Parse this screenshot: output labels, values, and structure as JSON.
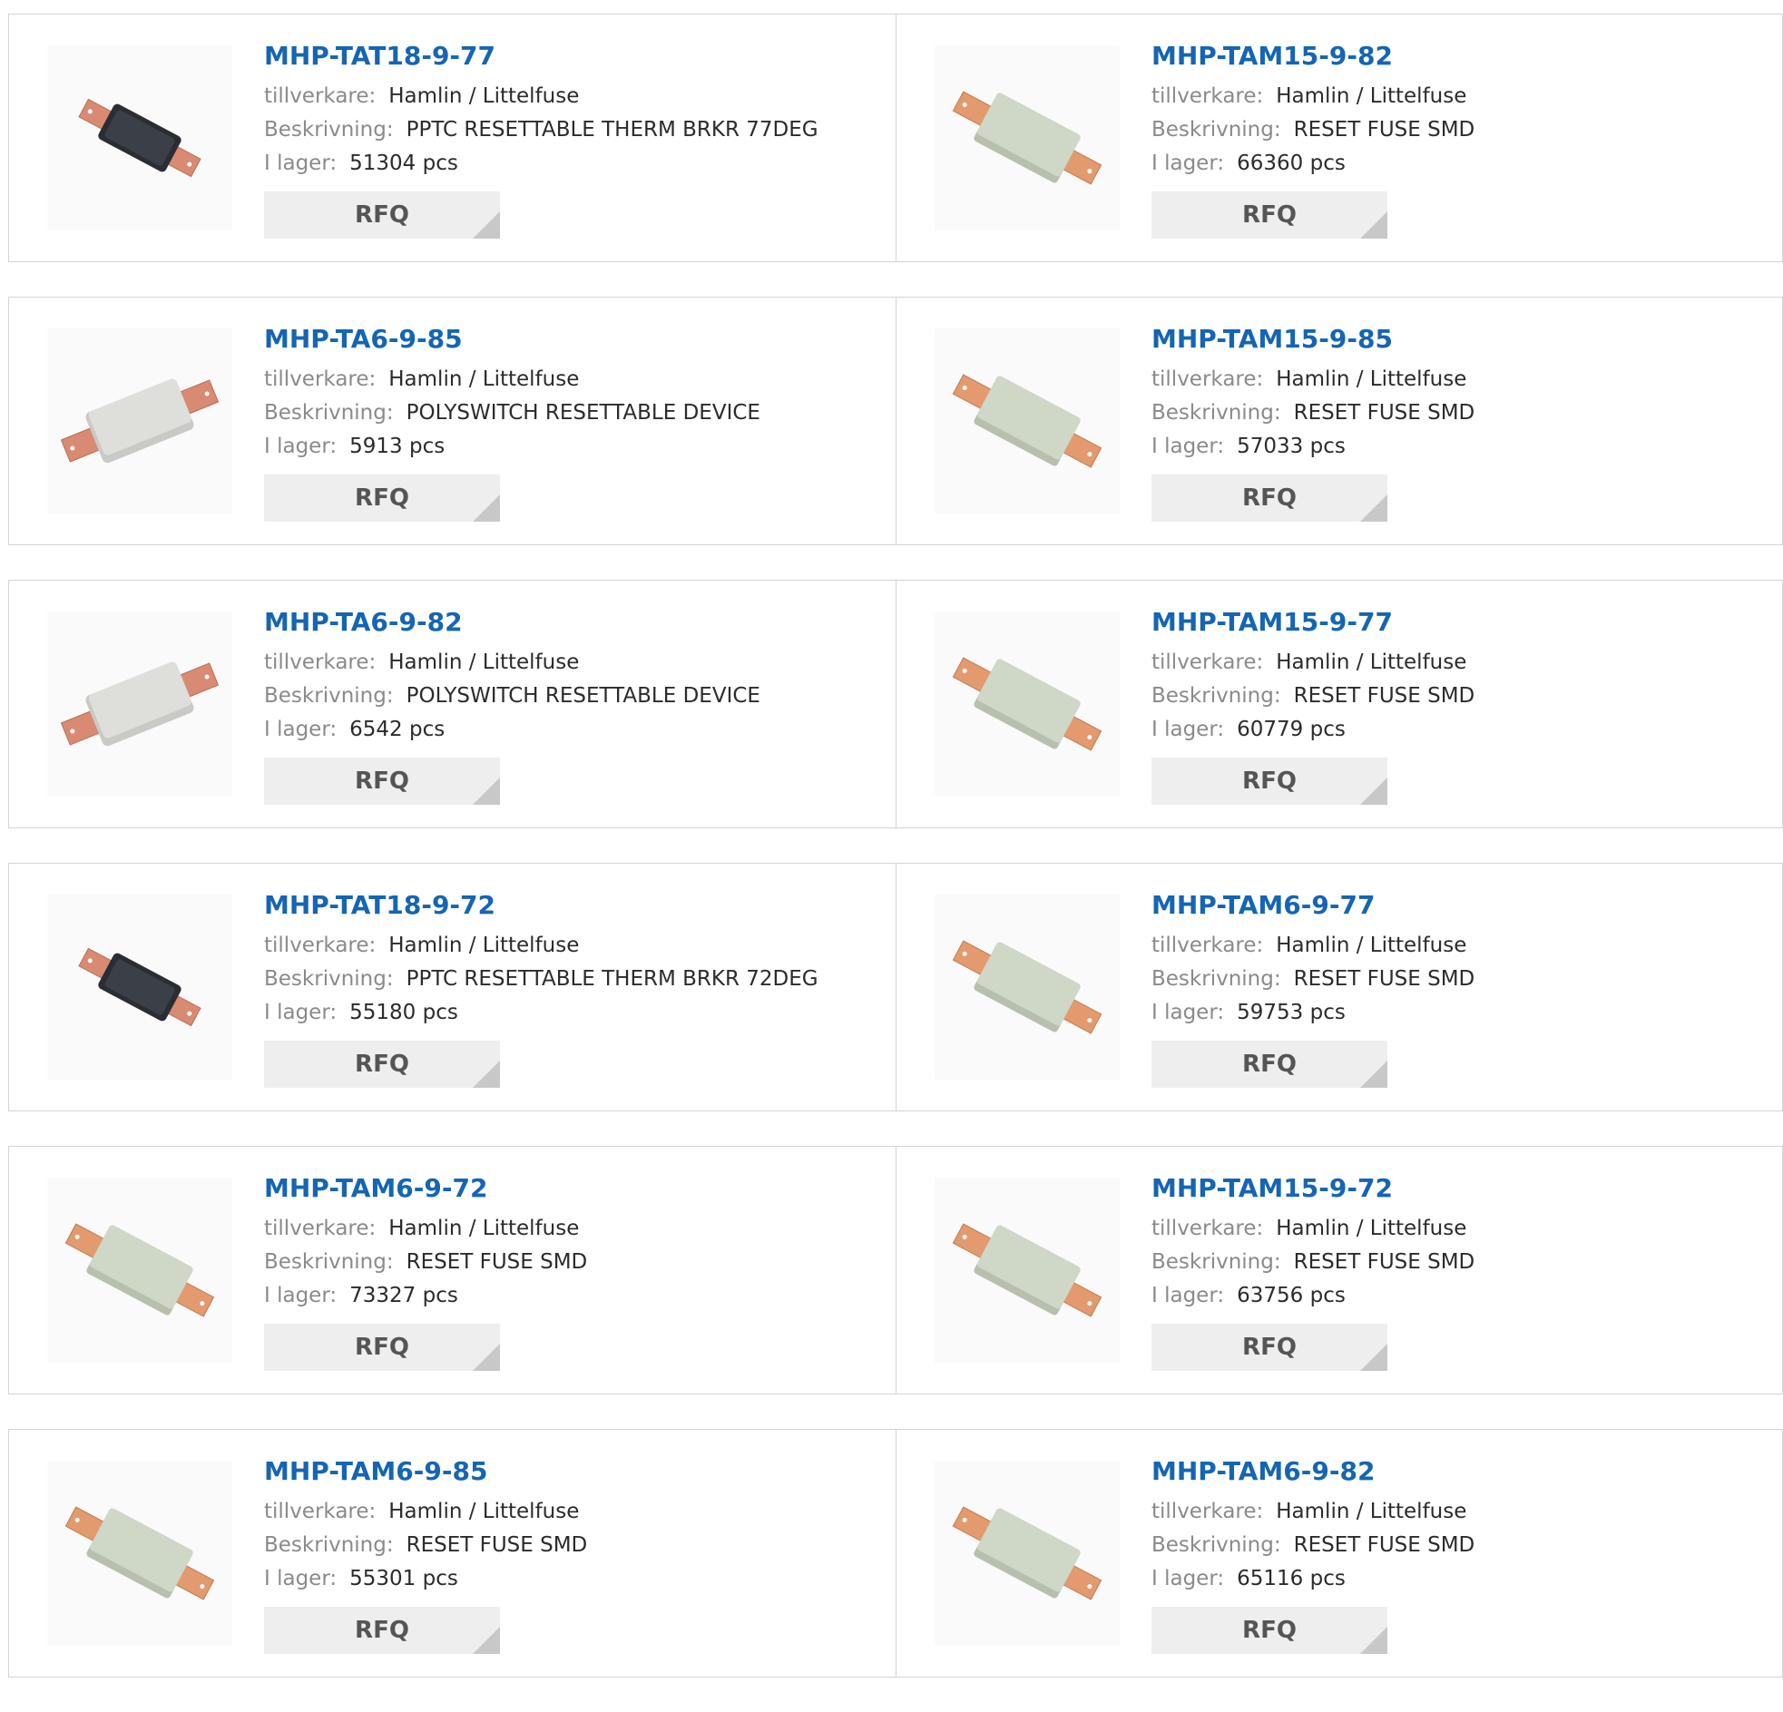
{
  "labels": {
    "manufacturer": "tillverkare:",
    "description": "Beskrivning:",
    "stock": "I lager:",
    "rfq": "RFQ"
  },
  "products": [
    {
      "part": "MHP-TAT18-9-77",
      "manufacturer": "Hamlin / Littelfuse",
      "description": "PPTC RESETTABLE THERM BRKR 77DEG",
      "stock": "51304 pcs",
      "image": "black-tat-fuse-icon"
    },
    {
      "part": "MHP-TAM15-9-82",
      "manufacturer": "Hamlin / Littelfuse",
      "description": "RESET FUSE SMD",
      "stock": "66360 pcs",
      "image": "green-tam-fuse-icon"
    },
    {
      "part": "MHP-TA6-9-85",
      "manufacturer": "Hamlin / Littelfuse",
      "description": "POLYSWITCH RESETTABLE DEVICE",
      "stock": "5913 pcs",
      "image": "grey-ta-fuse-icon"
    },
    {
      "part": "MHP-TAM15-9-85",
      "manufacturer": "Hamlin / Littelfuse",
      "description": "RESET FUSE SMD",
      "stock": "57033 pcs",
      "image": "green-tam-fuse-icon"
    },
    {
      "part": "MHP-TA6-9-82",
      "manufacturer": "Hamlin / Littelfuse",
      "description": "POLYSWITCH RESETTABLE DEVICE",
      "stock": "6542 pcs",
      "image": "grey-ta-fuse-icon"
    },
    {
      "part": "MHP-TAM15-9-77",
      "manufacturer": "Hamlin / Littelfuse",
      "description": "RESET FUSE SMD",
      "stock": "60779 pcs",
      "image": "green-tam-fuse-icon"
    },
    {
      "part": "MHP-TAT18-9-72",
      "manufacturer": "Hamlin / Littelfuse",
      "description": "PPTC RESETTABLE THERM BRKR 72DEG",
      "stock": "55180 pcs",
      "image": "black-tat-fuse-icon"
    },
    {
      "part": "MHP-TAM6-9-77",
      "manufacturer": "Hamlin / Littelfuse",
      "description": "RESET FUSE SMD",
      "stock": "59753 pcs",
      "image": "green-tam-fuse-icon"
    },
    {
      "part": "MHP-TAM6-9-72",
      "manufacturer": "Hamlin / Littelfuse",
      "description": "RESET FUSE SMD",
      "stock": "73327 pcs",
      "image": "green-tam-fuse-icon"
    },
    {
      "part": "MHP-TAM15-9-72",
      "manufacturer": "Hamlin / Littelfuse",
      "description": "RESET FUSE SMD",
      "stock": "63756 pcs",
      "image": "green-tam-fuse-icon"
    },
    {
      "part": "MHP-TAM6-9-85",
      "manufacturer": "Hamlin / Littelfuse",
      "description": "RESET FUSE SMD",
      "stock": "55301 pcs",
      "image": "green-tam-fuse-icon"
    },
    {
      "part": "MHP-TAM6-9-82",
      "manufacturer": "Hamlin / Littelfuse",
      "description": "RESET FUSE SMD",
      "stock": "65116 pcs",
      "image": "green-tam-fuse-icon"
    }
  ],
  "colors": {
    "link": "#1565b4",
    "label": "#8a8a8a",
    "value": "#2b2b2b",
    "button_bg": "#eeeeee",
    "button_text": "#555555",
    "border": "#d4d4d4"
  }
}
